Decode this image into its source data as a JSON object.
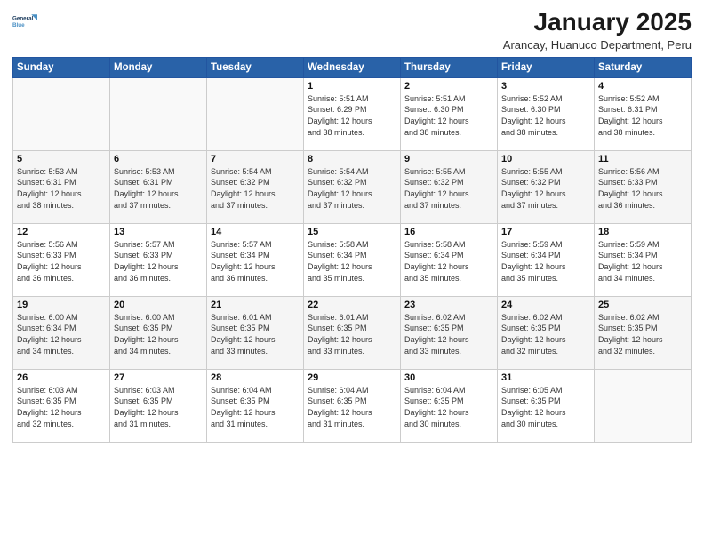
{
  "logo": {
    "line1": "General",
    "line2": "Blue"
  },
  "title": "January 2025",
  "subtitle": "Arancay, Huanuco Department, Peru",
  "weekdays": [
    "Sunday",
    "Monday",
    "Tuesday",
    "Wednesday",
    "Thursday",
    "Friday",
    "Saturday"
  ],
  "weeks": [
    [
      {
        "day": "",
        "info": ""
      },
      {
        "day": "",
        "info": ""
      },
      {
        "day": "",
        "info": ""
      },
      {
        "day": "1",
        "info": "Sunrise: 5:51 AM\nSunset: 6:29 PM\nDaylight: 12 hours\nand 38 minutes."
      },
      {
        "day": "2",
        "info": "Sunrise: 5:51 AM\nSunset: 6:30 PM\nDaylight: 12 hours\nand 38 minutes."
      },
      {
        "day": "3",
        "info": "Sunrise: 5:52 AM\nSunset: 6:30 PM\nDaylight: 12 hours\nand 38 minutes."
      },
      {
        "day": "4",
        "info": "Sunrise: 5:52 AM\nSunset: 6:31 PM\nDaylight: 12 hours\nand 38 minutes."
      }
    ],
    [
      {
        "day": "5",
        "info": "Sunrise: 5:53 AM\nSunset: 6:31 PM\nDaylight: 12 hours\nand 38 minutes."
      },
      {
        "day": "6",
        "info": "Sunrise: 5:53 AM\nSunset: 6:31 PM\nDaylight: 12 hours\nand 37 minutes."
      },
      {
        "day": "7",
        "info": "Sunrise: 5:54 AM\nSunset: 6:32 PM\nDaylight: 12 hours\nand 37 minutes."
      },
      {
        "day": "8",
        "info": "Sunrise: 5:54 AM\nSunset: 6:32 PM\nDaylight: 12 hours\nand 37 minutes."
      },
      {
        "day": "9",
        "info": "Sunrise: 5:55 AM\nSunset: 6:32 PM\nDaylight: 12 hours\nand 37 minutes."
      },
      {
        "day": "10",
        "info": "Sunrise: 5:55 AM\nSunset: 6:32 PM\nDaylight: 12 hours\nand 37 minutes."
      },
      {
        "day": "11",
        "info": "Sunrise: 5:56 AM\nSunset: 6:33 PM\nDaylight: 12 hours\nand 36 minutes."
      }
    ],
    [
      {
        "day": "12",
        "info": "Sunrise: 5:56 AM\nSunset: 6:33 PM\nDaylight: 12 hours\nand 36 minutes."
      },
      {
        "day": "13",
        "info": "Sunrise: 5:57 AM\nSunset: 6:33 PM\nDaylight: 12 hours\nand 36 minutes."
      },
      {
        "day": "14",
        "info": "Sunrise: 5:57 AM\nSunset: 6:34 PM\nDaylight: 12 hours\nand 36 minutes."
      },
      {
        "day": "15",
        "info": "Sunrise: 5:58 AM\nSunset: 6:34 PM\nDaylight: 12 hours\nand 35 minutes."
      },
      {
        "day": "16",
        "info": "Sunrise: 5:58 AM\nSunset: 6:34 PM\nDaylight: 12 hours\nand 35 minutes."
      },
      {
        "day": "17",
        "info": "Sunrise: 5:59 AM\nSunset: 6:34 PM\nDaylight: 12 hours\nand 35 minutes."
      },
      {
        "day": "18",
        "info": "Sunrise: 5:59 AM\nSunset: 6:34 PM\nDaylight: 12 hours\nand 34 minutes."
      }
    ],
    [
      {
        "day": "19",
        "info": "Sunrise: 6:00 AM\nSunset: 6:34 PM\nDaylight: 12 hours\nand 34 minutes."
      },
      {
        "day": "20",
        "info": "Sunrise: 6:00 AM\nSunset: 6:35 PM\nDaylight: 12 hours\nand 34 minutes."
      },
      {
        "day": "21",
        "info": "Sunrise: 6:01 AM\nSunset: 6:35 PM\nDaylight: 12 hours\nand 33 minutes."
      },
      {
        "day": "22",
        "info": "Sunrise: 6:01 AM\nSunset: 6:35 PM\nDaylight: 12 hours\nand 33 minutes."
      },
      {
        "day": "23",
        "info": "Sunrise: 6:02 AM\nSunset: 6:35 PM\nDaylight: 12 hours\nand 33 minutes."
      },
      {
        "day": "24",
        "info": "Sunrise: 6:02 AM\nSunset: 6:35 PM\nDaylight: 12 hours\nand 32 minutes."
      },
      {
        "day": "25",
        "info": "Sunrise: 6:02 AM\nSunset: 6:35 PM\nDaylight: 12 hours\nand 32 minutes."
      }
    ],
    [
      {
        "day": "26",
        "info": "Sunrise: 6:03 AM\nSunset: 6:35 PM\nDaylight: 12 hours\nand 32 minutes."
      },
      {
        "day": "27",
        "info": "Sunrise: 6:03 AM\nSunset: 6:35 PM\nDaylight: 12 hours\nand 31 minutes."
      },
      {
        "day": "28",
        "info": "Sunrise: 6:04 AM\nSunset: 6:35 PM\nDaylight: 12 hours\nand 31 minutes."
      },
      {
        "day": "29",
        "info": "Sunrise: 6:04 AM\nSunset: 6:35 PM\nDaylight: 12 hours\nand 31 minutes."
      },
      {
        "day": "30",
        "info": "Sunrise: 6:04 AM\nSunset: 6:35 PM\nDaylight: 12 hours\nand 30 minutes."
      },
      {
        "day": "31",
        "info": "Sunrise: 6:05 AM\nSunset: 6:35 PM\nDaylight: 12 hours\nand 30 minutes."
      },
      {
        "day": "",
        "info": ""
      }
    ]
  ]
}
